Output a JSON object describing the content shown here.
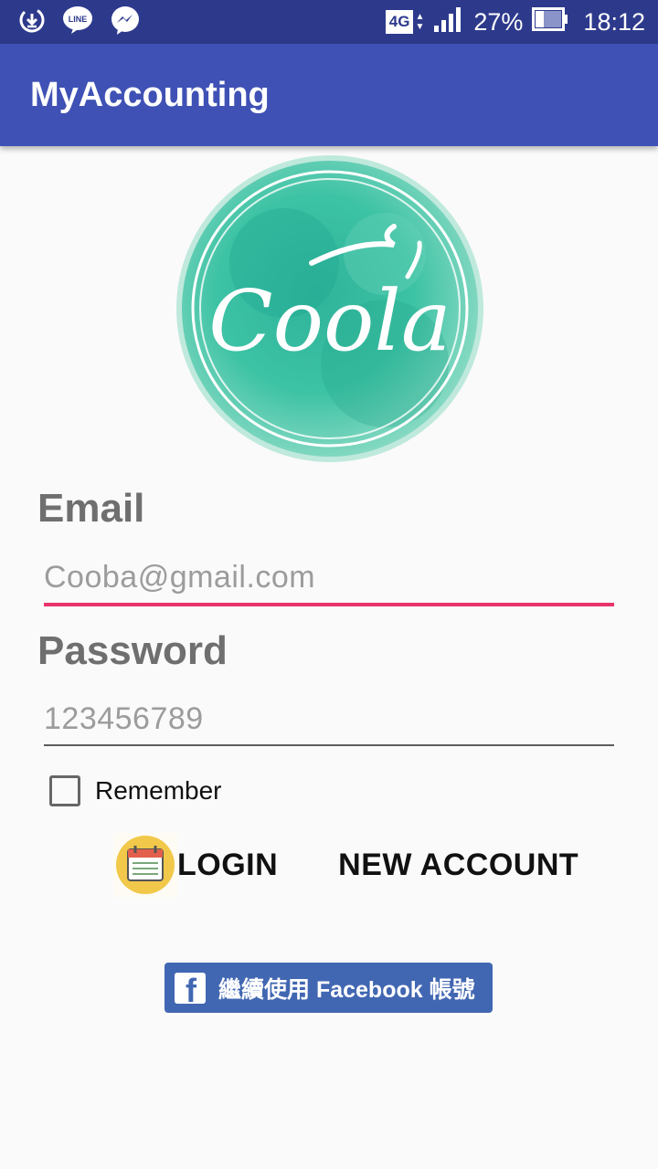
{
  "status_bar": {
    "icons": [
      "download-icon",
      "line-icon",
      "messenger-icon"
    ],
    "line_text": "LINE",
    "network": "4G",
    "battery_percent": "27%",
    "battery_level": 0.27,
    "time": "18:12"
  },
  "app_bar": {
    "title": "MyAccounting"
  },
  "logo": {
    "text": "Coola"
  },
  "form": {
    "email_label": "Email",
    "email_placeholder": "Cooba@gmail.com",
    "password_label": "Password",
    "password_placeholder": "123456789",
    "remember_label": "Remember",
    "remember_checked": false
  },
  "actions": {
    "login_label": "LOGIN",
    "new_account_label": "NEW ACCOUNT",
    "facebook_label": "繼續使用 Facebook 帳號"
  },
  "colors": {
    "status_bar": "#2d3a8c",
    "app_bar": "#3f51b5",
    "accent": "#e8336b",
    "facebook": "#4267b2"
  }
}
